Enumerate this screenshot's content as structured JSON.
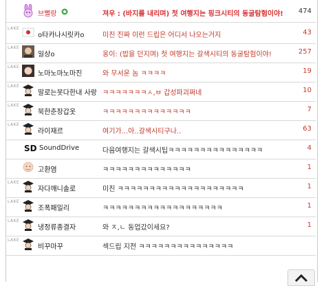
{
  "rows": [
    {
      "nick": "브뻘랑",
      "comment": "져우 : (바지를 내리며) 첫 여행지는 핑크시티의 동굴탐험이야!",
      "count": "474"
    },
    {
      "nick": "o타카나시릿카o",
      "comment": "미친 진짜 이런 드립은 어디서 나오는거지",
      "count": "43"
    },
    {
      "nick": "일상o",
      "comment": "옹이: (밥을 던지며) 첫 여행지는 갈색시티의 동굴탐험이야!",
      "count": "257"
    },
    {
      "nick": "노마노마노마진",
      "comment": "와 무서운 놈 ㅋㅋㅋㅋ",
      "count": "19"
    },
    {
      "nick": "말로는못다한내 사랑",
      "comment": "ㅋㅋㅋㅋㅋㅋㅋㅅ,ㅂ 갑성파괴쩌네",
      "count": "10"
    },
    {
      "nick": "북한춘장갑옷",
      "comment": "ㅋㅋㅋㅋㅋㅋㅋㅋㅋㅋㅋㅋㅋㅋ",
      "count": "7"
    },
    {
      "nick": "라이재르",
      "comment": "여기가...아..갈색시티구나..",
      "count": "63"
    },
    {
      "nick": "SoundDrive",
      "sd": "SD",
      "comment": "다음여행지는 갈색시팁ㅋㅋㅋㅋㅋㅋㅋㅋㅋㅋㅋㅋㅋㅋㅋ",
      "count": "4"
    },
    {
      "nick": "고환염",
      "comment": "ㅋㅋㅋㅋㅋㅋㅋㅋㅋㅋㅋㅋㅋㅋ",
      "count": "1"
    },
    {
      "nick": "자다깨니솔로",
      "comment": "미친 ㅋㅋㅋㅋㅋㅋㅋㅋㅋㅋㅋㅋㅋㅋㅋㅋㅋㅋㅋㅋ",
      "count": "1"
    },
    {
      "nick": "조폭패밀리",
      "comment": "ㅋㅋㅋㅋㅋㅋㅋㅋㅋㅋㅋㅋㅋㅋㅋㅋㅋㅋㅋ",
      "count": "1"
    },
    {
      "nick": "냉정류종결자",
      "comment": "와 ㅈ,ㄴ 동업갔이세요?",
      "count": "1"
    },
    {
      "nick": "비꾸마꾸",
      "comment": "섹드립 지전 ㅋㅋㅋㅋㅋㅋㅋㅋㅋㅋㅋㅋㅋㅋㅋ",
      "count": ""
    }
  ],
  "tag_label": "LAKE",
  "icons": {
    "first_avatar": "bunny-icon",
    "default_avatar": "graduate-icon",
    "badge": "green-badge-icon",
    "scroll_top": "chevron-up-icon"
  },
  "colors": {
    "accent": "#c0392b",
    "border": "#d8d8d8"
  }
}
